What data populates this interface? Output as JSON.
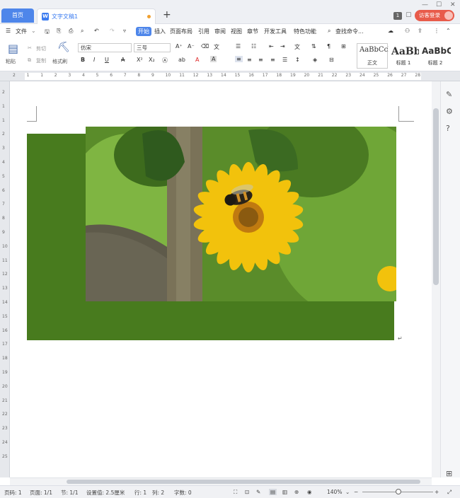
{
  "tabs": {
    "home": "首页",
    "document": "文字文稿1"
  },
  "window": {
    "page_badge": "1",
    "login": "访客登录"
  },
  "menu": {
    "file": "文件",
    "items": [
      "开始",
      "插入",
      "页面布局",
      "引用",
      "审阅",
      "视图",
      "章节",
      "开发工具",
      "特色功能"
    ],
    "search": "查找命令..."
  },
  "ribbon": {
    "paste": "粘贴",
    "cut": "剪切",
    "copy": "复制",
    "format_painter": "格式刷",
    "font_name": "仿宋",
    "font_size": "三号",
    "styles": [
      {
        "sample": "AaBbCcDd",
        "label": "正文"
      },
      {
        "sample": "AaBb",
        "label": "标题 1"
      },
      {
        "sample": "AaBbC",
        "label": "标题 2"
      }
    ]
  },
  "ruler": {
    "h_ticks": [
      "2",
      "1",
      "1",
      "2",
      "3",
      "4",
      "5",
      "6",
      "7",
      "8",
      "9",
      "10",
      "11",
      "12",
      "13",
      "14",
      "15",
      "16",
      "17",
      "18",
      "19",
      "20",
      "21",
      "22",
      "23",
      "24",
      "25",
      "26",
      "27",
      "28"
    ],
    "v_ticks": [
      "2",
      "1",
      "1",
      "2",
      "3",
      "4",
      "5",
      "6",
      "7",
      "8",
      "9",
      "10",
      "11",
      "12",
      "13",
      "14",
      "15",
      "16",
      "17",
      "18",
      "19",
      "20",
      "21",
      "22",
      "23",
      "24",
      "25"
    ]
  },
  "status": {
    "page_num": "页码: 1",
    "pages": "页面: 1/1",
    "section": "节: 1/1",
    "setting": "设置值: 2.5厘米",
    "row": "行: 1",
    "col": "列: 2",
    "words": "字数: 0",
    "zoom": "140%"
  },
  "colors": {
    "accent": "#4e86ea",
    "login": "#e85b4a",
    "shape_fill": "#487b1e",
    "flower": "#f2c20c"
  },
  "icons": {
    "cut": "scissors-icon",
    "copy": "copy-icon",
    "paste": "clipboard-icon"
  }
}
